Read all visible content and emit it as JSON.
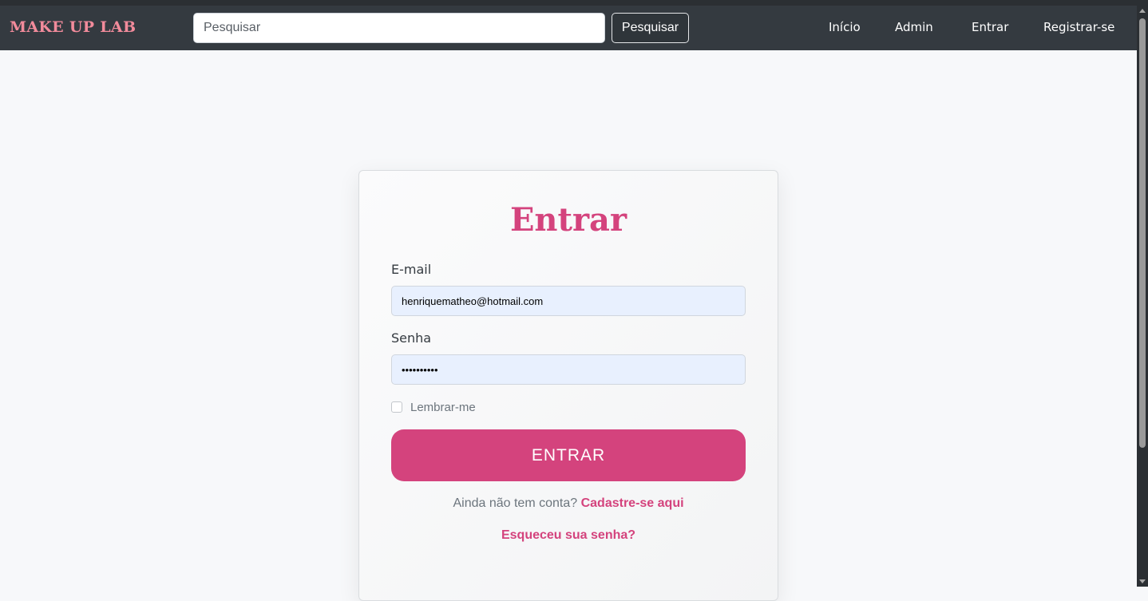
{
  "navbar": {
    "brand": "MAKE UP LAB",
    "search": {
      "placeholder": "Pesquisar",
      "button_label": "Pesquisar"
    },
    "links": [
      {
        "label": "Início"
      },
      {
        "label": "Admin"
      },
      {
        "label": "Entrar"
      },
      {
        "label": "Registrar-se"
      }
    ]
  },
  "login": {
    "title": "Entrar",
    "email_label": "E-mail",
    "email_value": "henriquematheo@hotmail.com",
    "password_label": "Senha",
    "password_value": "1234567890",
    "remember_label": "Lembrar-me",
    "submit_label": "ENTRAR",
    "signup_prompt": "Ainda não tem conta?",
    "signup_link": "Cadastre-se aqui",
    "forgot_link": "Esqueceu sua senha?"
  },
  "colors": {
    "navbar_bg": "#343a40",
    "brand": "#f28b9b",
    "accent": "#d4437d",
    "page_bg": "#f7f8fa",
    "autofill_bg": "#e8f0fe"
  }
}
